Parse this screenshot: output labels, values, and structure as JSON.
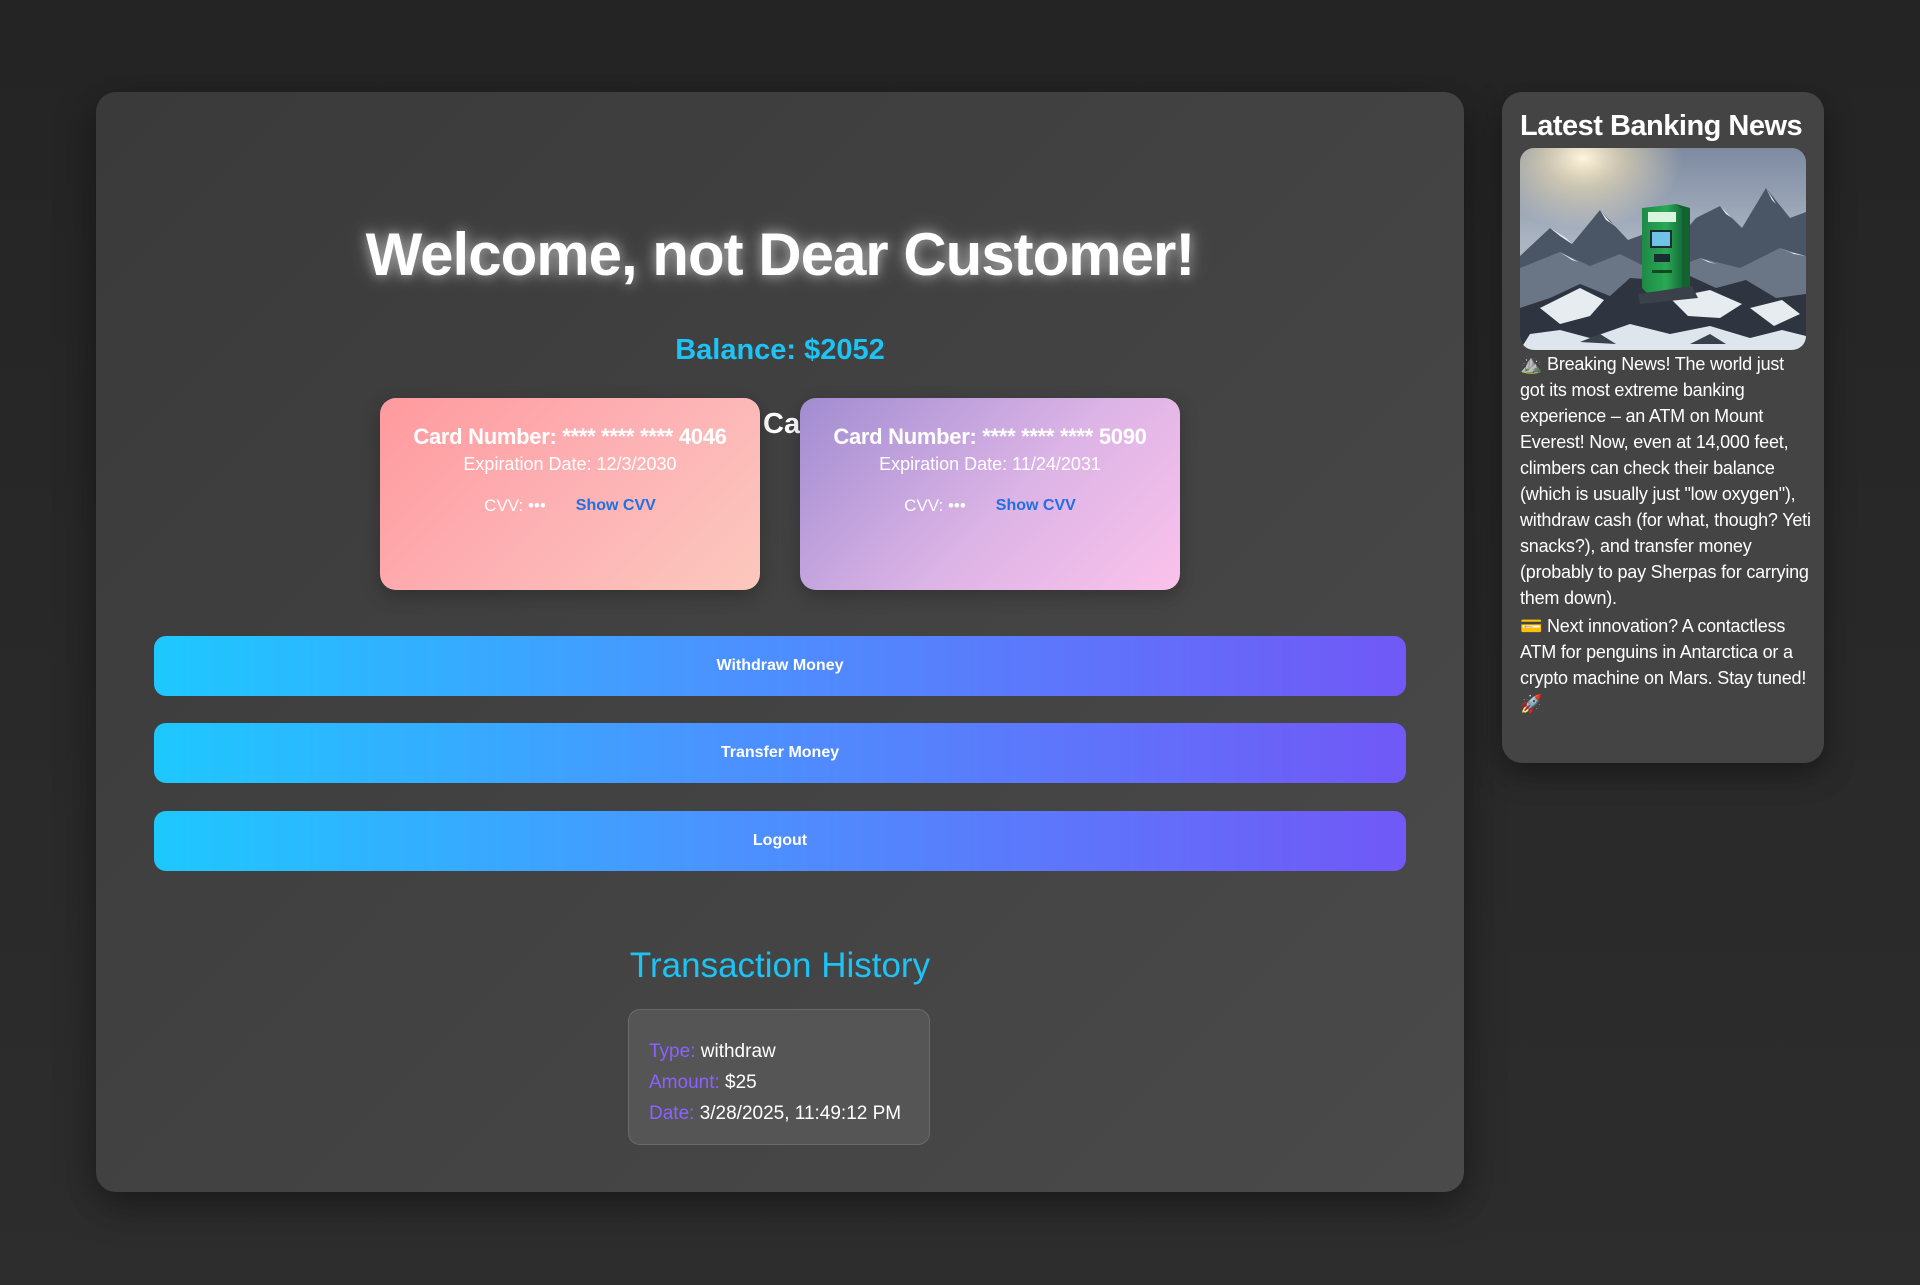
{
  "welcome": {
    "title": "Welcome, not Dear Customer!"
  },
  "balance": {
    "text": "Balance: $2052"
  },
  "cards_section": {
    "title": "My Cards",
    "cards": [
      {
        "number": "Card Number: **** **** **** 4046",
        "expiration": "Expiration Date: 12/3/2030",
        "cvv": "CVV: •••",
        "show_cvv_label": "Show CVV"
      },
      {
        "number": "Card Number: **** **** **** 5090",
        "expiration": "Expiration Date: 11/24/2031",
        "cvv": "CVV: •••",
        "show_cvv_label": "Show CVV"
      }
    ]
  },
  "actions": {
    "withdraw_label": "Withdraw Money",
    "transfer_label": "Transfer Money",
    "logout_label": "Logout"
  },
  "history": {
    "title": "Transaction History",
    "transactions": [
      {
        "type_key": "Type:",
        "type_value": "withdraw",
        "amount_key": "Amount:",
        "amount_value": "$25",
        "date_key": "Date:",
        "date_value": "3/28/2025, 11:49:12 PM"
      }
    ]
  },
  "news": {
    "title": "Latest Banking News",
    "image_icon": "atm-on-mountain-image",
    "paragraph_1": "⛰️ Breaking News! The world just got its most extreme banking experience – an ATM on Mount Everest! Now, even at 14,000 feet, climbers can check their balance (which is usually just \"low oxygen\"), withdraw cash (for what, though? Yeti snacks?), and transfer money (probably to pay Sherpas for carrying them down).",
    "paragraph_2": "💳 Next innovation? A contactless ATM for penguins in Antarctica or a crypto machine on Mars. Stay tuned! 🚀"
  },
  "colors": {
    "accent_cyan": "#1ec3f5",
    "accent_purple": "#8a62ff",
    "card_1_gradient": [
      "#ff9a9e",
      "#fcc8bd"
    ],
    "card_2_gradient": [
      "#a18cd1",
      "#fbc2eb"
    ],
    "button_gradient": [
      "#1ec8ff",
      "#7158f7"
    ]
  }
}
